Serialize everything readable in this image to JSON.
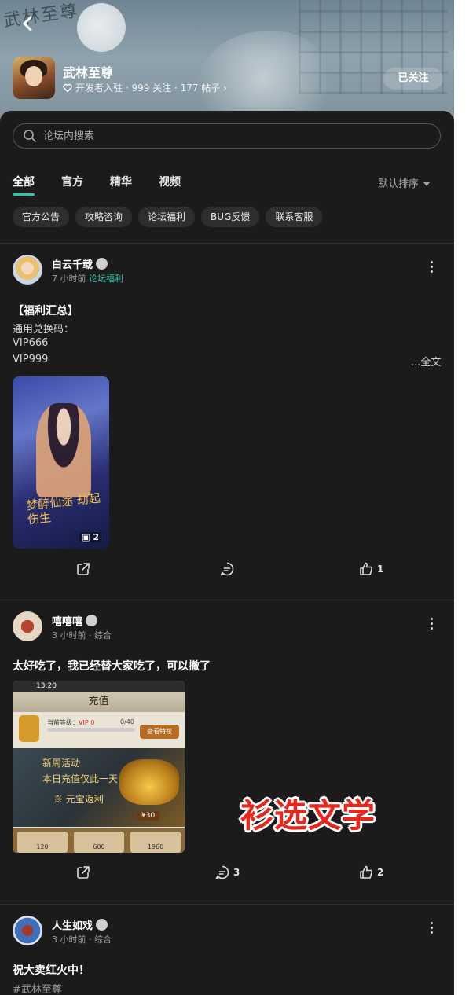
{
  "banner": {
    "calligraphy": "武林至尊"
  },
  "forum": {
    "name": "武林至尊",
    "stats": "开发者入驻 · 999 关注 · 177 帖子 ›",
    "follow_label": "已关注"
  },
  "search": {
    "placeholder": "论坛内搜索"
  },
  "tabs": [
    {
      "label": "全部",
      "active": true
    },
    {
      "label": "官方"
    },
    {
      "label": "精华"
    },
    {
      "label": "视频"
    }
  ],
  "sort_label": "默认排序",
  "chips": [
    "官方公告",
    "攻略咨询",
    "论坛福利",
    "BUG反馈",
    "联系客服"
  ],
  "posts": [
    {
      "author": "白云千载",
      "time": "7 小时前",
      "category": "论坛福利",
      "title": "【福利汇总】",
      "lines": [
        "通用兑换码：",
        "VIP666",
        "VIP999"
      ],
      "fulltext_label": "...全文",
      "image": {
        "calligraphy": "梦醉仙途 劫起伤生",
        "count": "2"
      },
      "comments": "",
      "likes": "1"
    },
    {
      "author": "嘻嘻嘻",
      "time": "3 小时前",
      "category": "综合",
      "title": "太好吃了，我已经替大家吃了，可以撤了",
      "image": {
        "status_time": "13:20",
        "header": "充值",
        "level_label": "当前等级：",
        "level_value": "VIP 0",
        "progress": "0/40",
        "button": "查看特权",
        "promo_1": "新周活动",
        "promo_2": "本日充值仅此一天",
        "promo_3": "※ 元宝返利",
        "price": "¥30",
        "cells": [
          "120",
          "600",
          "1960"
        ]
      },
      "comments": "3",
      "likes": "2"
    },
    {
      "author": "人生如戏",
      "time": "3 小时前",
      "category": "综合",
      "title": "祝大卖红火中！",
      "hashtag": "#武林至尊"
    }
  ],
  "watermark": "衫选文学",
  "colors": {
    "accent": "#2cc9a6",
    "background": "#1b1b1c",
    "watermark": "#e8261c"
  }
}
